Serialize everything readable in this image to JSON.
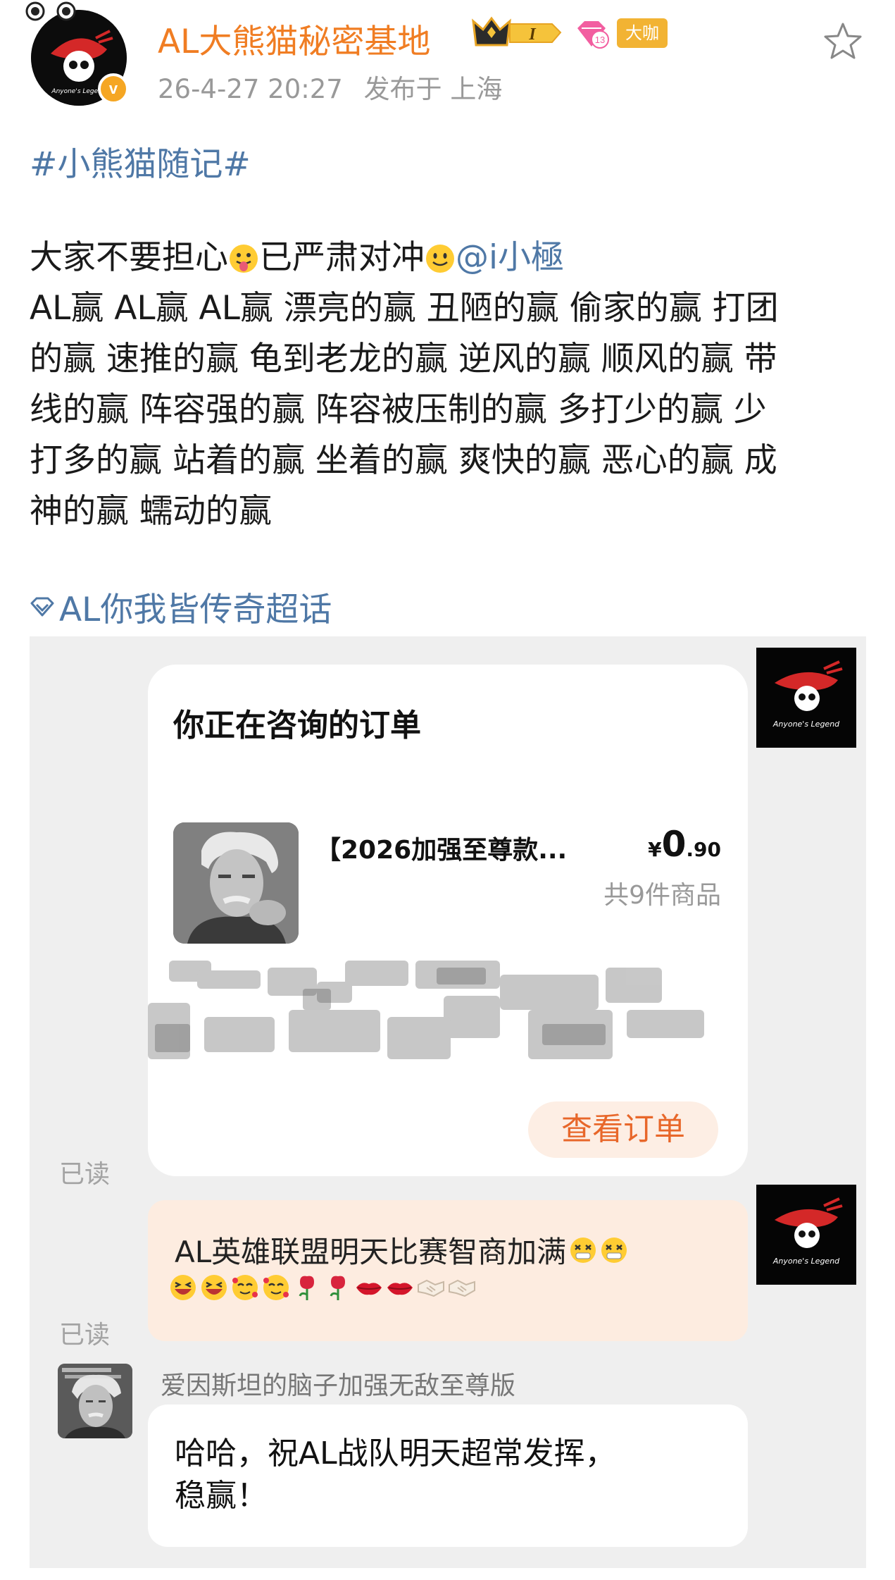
{
  "post": {
    "user_name": "AL大熊猫秘密基地",
    "verified_badge": "v",
    "vip_tag": "大咖",
    "level_badge": "13",
    "crown_badge_letter": "I",
    "timestamp": "26-4-27 20:27",
    "location": "发布于 上海",
    "hashtag": "#小熊猫随记#",
    "body_part1": "大家不要担心",
    "body_part2": "已严肃对冲",
    "mention": "@i小極",
    "win_lines": [
      "AL赢 AL赢 AL赢 漂亮的赢 丑陋的赢 偷家的赢 打团",
      "的赢 速推的赢 龟到老龙的赢 逆风的赢 顺风的赢 带",
      "线的赢 阵容强的赢 阵容被压制的赢 多打少的赢 少",
      "打多的赢 站着的赢 坐着的赢 爽快的赢 恶心的赢 成",
      "神的赢 蠕动的赢"
    ],
    "super_topic": "AL你我皆传奇超话"
  },
  "screenshot": {
    "order_card": {
      "title": "你正在咨询的订单",
      "product_name": "【2026加强至尊款...",
      "price_currency": "¥",
      "price_integer": "0",
      "price_decimal": ".90",
      "item_count": "共9件商品",
      "view_order_button": "查看订单"
    },
    "read_label_1": "已读",
    "read_label_2": "已读",
    "shop_logo_caption": "Anyone's Legend",
    "message_line1": "AL英雄联盟明天比赛智商加满",
    "reply": {
      "sender_name": "爱因斯坦的脑子加强无敌至尊版",
      "text_line1": "哈哈，祝AL战队明天超常发挥，",
      "text_line2": "稳赢！"
    },
    "emojis_line1": [
      "dizzy-face",
      "dizzy-face"
    ],
    "emojis_line2": [
      "grinning-squint",
      "grinning-squint",
      "smiling-hearts",
      "smiling-hearts",
      "rose",
      "rose",
      "lips",
      "lips",
      "handshake",
      "handshake"
    ]
  },
  "colors": {
    "username": "#f07d23",
    "link": "#4f78a6",
    "vip": "#f2b333",
    "bubble": "#fdece0",
    "button_text": "#e8672a"
  }
}
